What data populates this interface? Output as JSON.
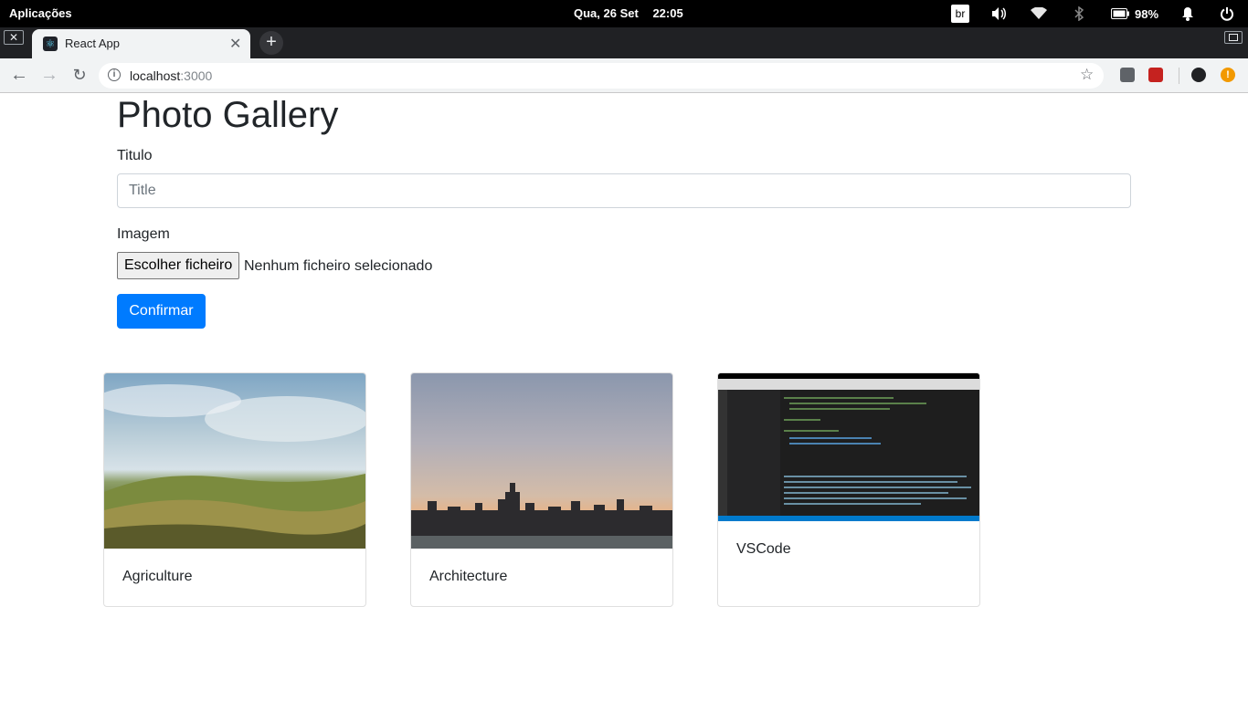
{
  "system_bar": {
    "apps_label": "Aplicações",
    "date": "Qua, 26 Set",
    "time": "22:05",
    "keyboard_layout": "br",
    "battery": "98%"
  },
  "browser": {
    "tab_title": "React App",
    "url_host": "localhost",
    "url_port": ":3000"
  },
  "page": {
    "heading": "Photo Gallery",
    "title_label": "Titulo",
    "title_placeholder": "Title",
    "title_value": "",
    "image_label": "Imagem",
    "file_button_label": "Escolher ficheiro",
    "file_status": "Nenhum ficheiro selecionado",
    "submit_label": "Confirmar"
  },
  "gallery": [
    {
      "caption": "Agriculture"
    },
    {
      "caption": "Architecture"
    },
    {
      "caption": "VSCode"
    }
  ],
  "colors": {
    "primary": "#007bff",
    "text": "#212529",
    "system_bar": "#000000",
    "tab_strip": "#202124"
  }
}
